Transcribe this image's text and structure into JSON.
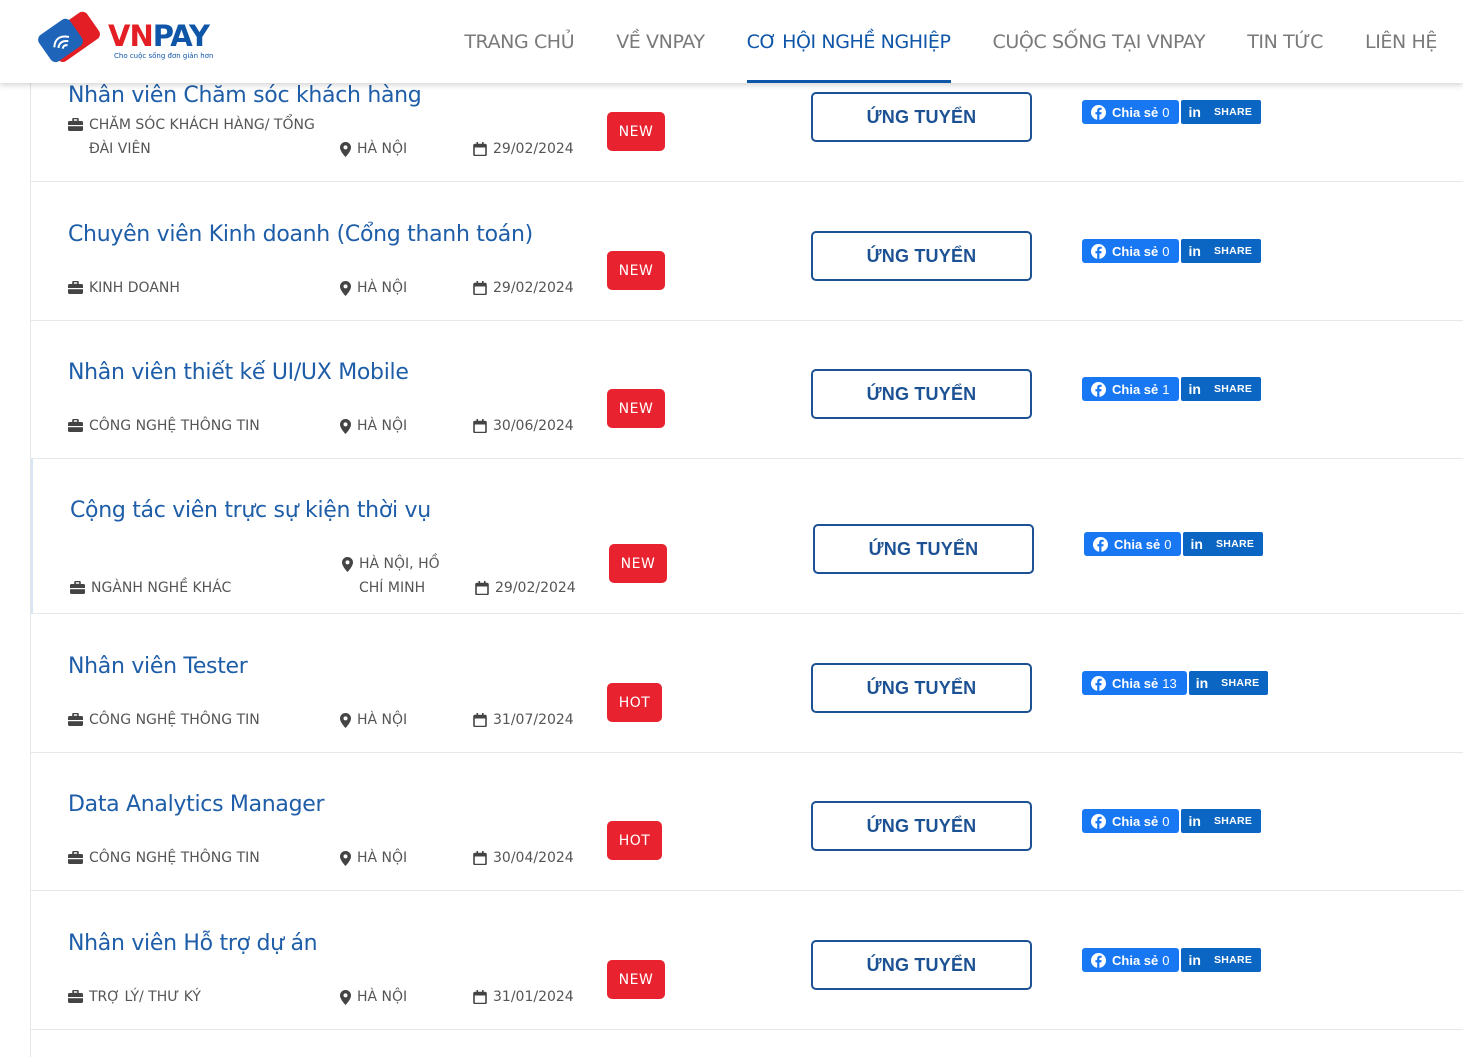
{
  "header": {
    "logo": {
      "brand_vn": "VN",
      "brand_pay": "PAY",
      "slogan": "Cho cuộc sống đơn giản hơn"
    },
    "nav": [
      {
        "label": "TRANG CHỦ",
        "active": false
      },
      {
        "label": "VỀ VNPAY",
        "active": false
      },
      {
        "label": "CƠ HỘI NGHỀ NGHIỆP",
        "active": true
      },
      {
        "label": "CUỘC SỐNG TẠI VNPAY",
        "active": false
      },
      {
        "label": "TIN TỨC",
        "active": false
      },
      {
        "label": "LIÊN HỆ",
        "active": false
      }
    ]
  },
  "jobs": [
    {
      "title": "Nhân viên Chăm sóc khách hàng",
      "category": "CHĂM SÓC KHÁCH HÀNG/ TỔNG ĐÀI VIÊN",
      "location": "HÀ NỘI",
      "deadline": "29/02/2024",
      "badge": "NEW",
      "apply_label": "ỨNG TUYỂN",
      "fb_label": "Chia sẻ",
      "fb_count": "0",
      "li_label": "SHARE",
      "li_icon": "in"
    },
    {
      "title": "Chuyên viên Kinh doanh (Cổng thanh toán)",
      "category": "KINH DOANH",
      "location": "HÀ NỘI",
      "deadline": "29/02/2024",
      "badge": "NEW",
      "apply_label": "ỨNG TUYỂN",
      "fb_label": "Chia sẻ",
      "fb_count": "0",
      "li_label": "SHARE",
      "li_icon": "in"
    },
    {
      "title": "Nhân viên thiết kế UI/UX Mobile",
      "category": "CÔNG NGHỆ THÔNG TIN",
      "location": "HÀ NỘI",
      "deadline": "30/06/2024",
      "badge": "NEW",
      "apply_label": "ỨNG TUYỂN",
      "fb_label": "Chia sẻ",
      "fb_count": "1",
      "li_label": "SHARE",
      "li_icon": "in"
    },
    {
      "title": "Cộng tác viên trực sự kiện thời vụ",
      "category": "NGÀNH NGHỀ KHÁC",
      "location": "HÀ NỘI, HỒ CHÍ MINH",
      "deadline": "29/02/2024",
      "badge": "NEW",
      "apply_label": "ỨNG TUYỂN",
      "fb_label": "Chia sẻ",
      "fb_count": "0",
      "li_label": "SHARE",
      "li_icon": "in"
    },
    {
      "title": "Nhân viên Tester",
      "category": "CÔNG NGHỆ THÔNG TIN",
      "location": "HÀ NỘI",
      "deadline": "31/07/2024",
      "badge": "HOT",
      "apply_label": "ỨNG TUYỂN",
      "fb_label": "Chia sẻ",
      "fb_count": "13",
      "li_label": "SHARE",
      "li_icon": "in"
    },
    {
      "title": "Data Analytics Manager",
      "category": "CÔNG NGHỆ THÔNG TIN",
      "location": "HÀ NỘI",
      "deadline": "30/04/2024",
      "badge": "HOT",
      "apply_label": "ỨNG TUYỂN",
      "fb_label": "Chia sẻ",
      "fb_count": "0",
      "li_label": "SHARE",
      "li_icon": "in"
    },
    {
      "title": "Nhân viên Hỗ trợ dự án",
      "category": "TRỢ LÝ/ THƯ KÝ",
      "location": "HÀ NỘI",
      "deadline": "31/01/2024",
      "badge": "NEW",
      "apply_label": "ỨNG TUYỂN",
      "fb_label": "Chia sẻ",
      "fb_count": "0",
      "li_label": "SHARE",
      "li_icon": "in"
    }
  ],
  "colors": {
    "brand_blue": "#0f56a8",
    "brand_red": "#e31e24",
    "badge_red": "#e8232f",
    "facebook": "#1877f2",
    "linkedin": "#0a66c2"
  }
}
